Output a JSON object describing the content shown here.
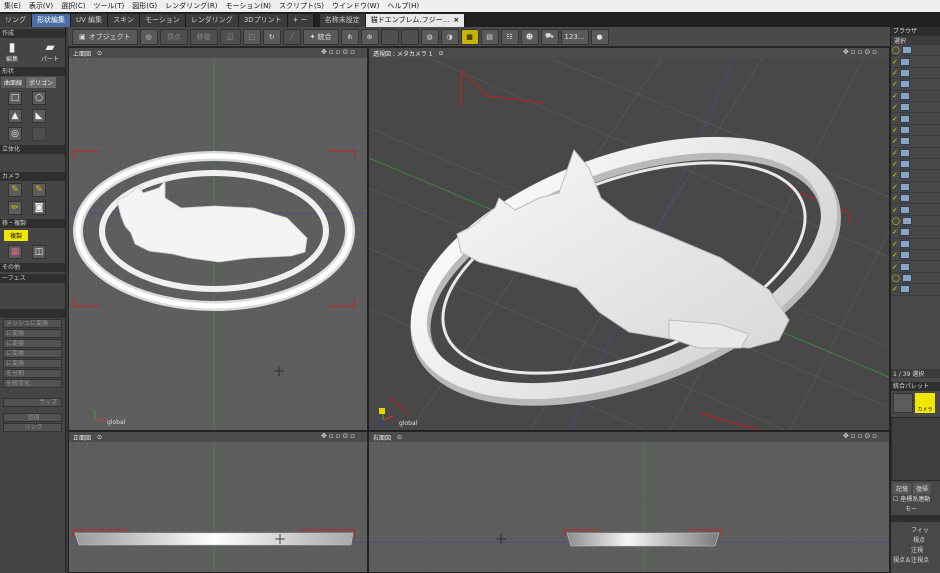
{
  "menu": [
    "集(E)",
    "表示(V)",
    "選択(C)",
    "ツール(T)",
    "図形(G)",
    "レンダリング(R)",
    "モーション(N)",
    "スクリプト(S)",
    "ウインドウ(W)",
    "ヘルプ(H)"
  ],
  "tabs": [
    {
      "label": "リング",
      "state": "normal"
    },
    {
      "label": "形状編集",
      "state": "hl"
    },
    {
      "label": "UV 編集",
      "state": "normal"
    },
    {
      "label": "スキン",
      "state": "normal"
    },
    {
      "label": "モーション",
      "state": "normal"
    },
    {
      "label": "レンダリング",
      "state": "normal"
    },
    {
      "label": "3Dプリント",
      "state": "normal"
    },
    {
      "label": "+ ー",
      "state": "normal"
    },
    {
      "label": "名称未設定",
      "state": "normal"
    },
    {
      "label": "猫ドエンブレム.フジー...",
      "state": "doc"
    }
  ],
  "toolbar": {
    "object_label": "オブジェクト",
    "add_label": "頂点",
    "move_label": "移植",
    "scale_label": "辺",
    "merge_label": "統合",
    "badge_label": "123..."
  },
  "left": {
    "create_label": "作成",
    "edit_label": "編集",
    "part_label": "パート",
    "shape_label": "形状",
    "curve_tab": "曲面線",
    "polygon_tab": "ポリゴン",
    "solid_label": "立体化",
    "camera_label": "カメラ",
    "copy_label": "移・複製",
    "copy_btn": "複製",
    "other_label": "その他",
    "surface_label": "ーフェス",
    "ops": [
      "メッシュに変換",
      "に変換",
      "に変換",
      "に変換",
      "に変換",
      "を分割",
      "を統合化"
    ],
    "wrap_label": "ラップ",
    "add_label": "追加",
    "link_label": "リンク"
  },
  "viewports": {
    "top_left": {
      "title": "上面図"
    },
    "top_right": {
      "title": "透視図 : メタカメラ 1"
    },
    "bottom_left": {
      "title": "正面図"
    },
    "bottom_right": {
      "title": "右面図"
    },
    "axis_label": "global"
  },
  "right": {
    "browser_title": "ブラウザ",
    "select_label": "選択",
    "selection_count": "1 / 39 選択",
    "palette_title": "統合パレット",
    "camera_label": "カメラ",
    "memory_label": "記憶",
    "restore_label": "復帰",
    "coord_label": "座標系連動",
    "model_label": "モー",
    "fit_label": "フィッ",
    "viewpoint_label": "視点",
    "gaze_label": "注視",
    "both_label": "視点＆注視点"
  },
  "colors": {
    "viewport_bg": "#5d5d5d",
    "perspective_bg": "#4a4a4a",
    "grid": "#6a6a6a",
    "red_marker": "#d02020",
    "accent_yellow": "#f1e800",
    "tab_highlight": "#4a6fa5"
  }
}
